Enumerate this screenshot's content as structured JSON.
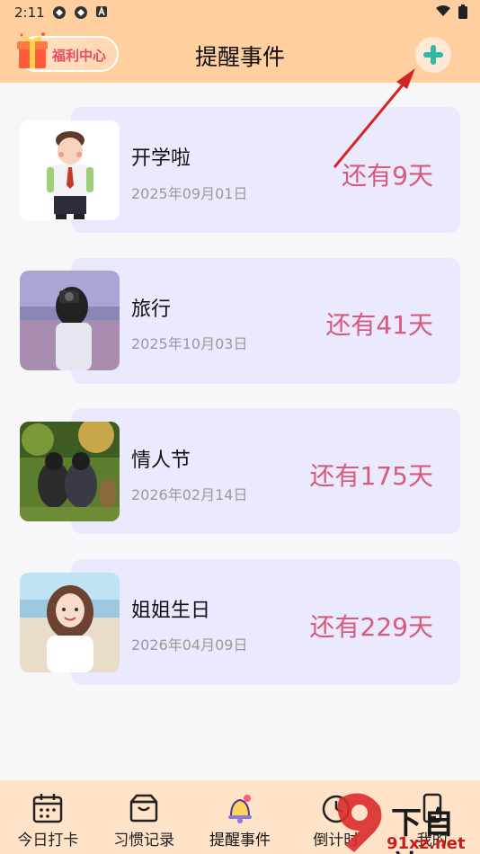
{
  "status_bar": {
    "time": "2:11",
    "notification_icons": [
      "app-icon",
      "app-icon",
      "a-icon"
    ],
    "system_icons": [
      "wifi-icon",
      "battery-icon"
    ]
  },
  "header": {
    "welfare_label": "福利中心",
    "title": "提醒事件",
    "add_icon": "plus-icon"
  },
  "events": [
    {
      "title": "开学啦",
      "date": "2025年09月01日",
      "remaining": "还有9天",
      "image": "student-photo"
    },
    {
      "title": "旅行",
      "date": "2025年10月03日",
      "remaining": "还有41天",
      "image": "travel-photo"
    },
    {
      "title": "情人节",
      "date": "2026年02月14日",
      "remaining": "还有175天",
      "image": "couple-photo"
    },
    {
      "title": "姐姐生日",
      "date": "2026年04月09日",
      "remaining": "还有229天",
      "image": "girl-photo"
    }
  ],
  "tabs": [
    {
      "label": "今日打卡",
      "icon": "calendar-icon",
      "active": false
    },
    {
      "label": "习惯记录",
      "icon": "box-icon",
      "active": false
    },
    {
      "label": "提醒事件",
      "icon": "bell-icon",
      "active": true
    },
    {
      "label": "倒计时",
      "icon": "clock-icon",
      "active": false
    },
    {
      "label": "我的",
      "icon": "phone-icon",
      "active": false
    }
  ],
  "watermark": {
    "text": "下自站",
    "site": "91xz.net"
  },
  "colors": {
    "header_bg": "#ffcf9f",
    "card_bg": "#eae9fd",
    "remaining_text": "#d85a7a",
    "tabbar_bg": "#ffe3c8",
    "add_icon": "#35b7a8"
  }
}
